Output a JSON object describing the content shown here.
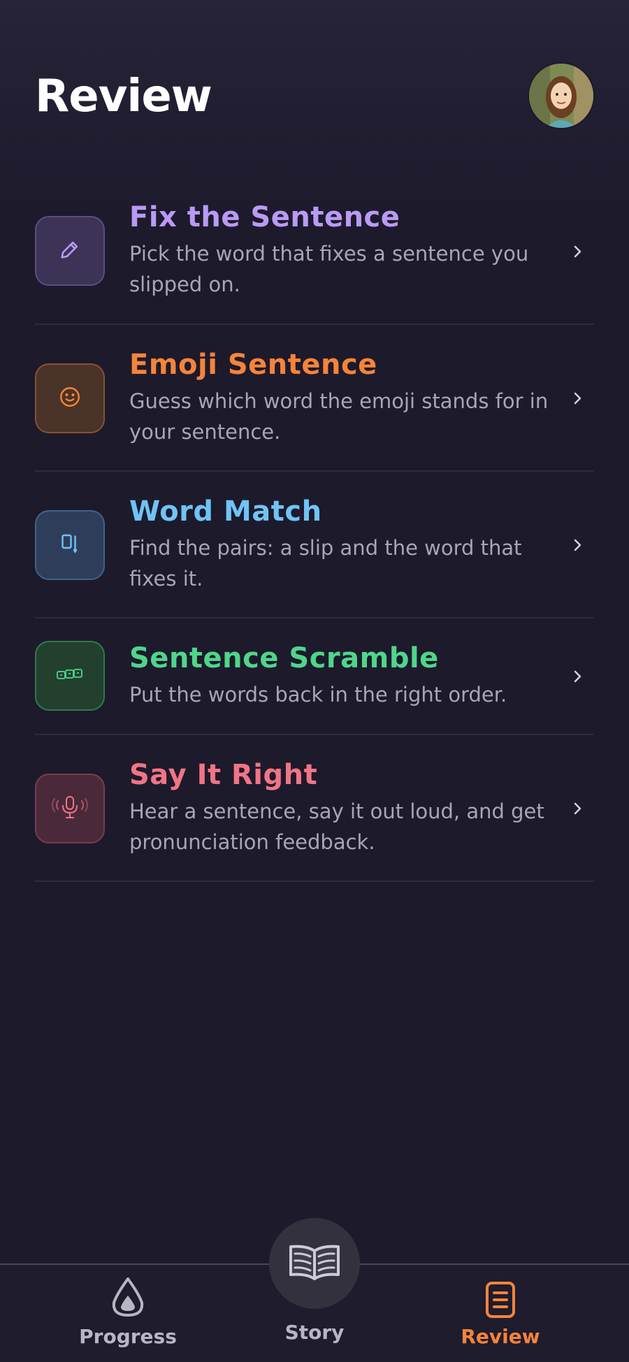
{
  "header": {
    "title": "Review"
  },
  "colors": {
    "background": "#1d1a2c",
    "divider": "#2e2b3e",
    "description": "#a9a5b8",
    "purple": "#b99bf5",
    "orange": "#f5843a",
    "blue": "#6fc4f5",
    "green": "#4fd68a",
    "pink": "#f07585",
    "nav_active": "#f5843a",
    "nav_inactive": "#b8b5c4"
  },
  "review_items": [
    {
      "title": "Fix the Sentence",
      "description": "Pick the word that fixes a sentence you slipped on.",
      "icon": "pencil-icon",
      "color": "#b99bf5"
    },
    {
      "title": "Emoji Sentence",
      "description": "Guess which word the emoji stands for in your sentence.",
      "icon": "smiley-icon",
      "color": "#f5843a"
    },
    {
      "title": "Word Match",
      "description": "Find the pairs: a slip and the word that fixes it.",
      "icon": "match-cards-icon",
      "color": "#6fc4f5"
    },
    {
      "title": "Sentence Scramble",
      "description": "Put the words back in the right order.",
      "icon": "word-blocks-icon",
      "color": "#4fd68a"
    },
    {
      "title": "Say It Right",
      "description": "Hear a sentence, say it out loud, and get pronunciation feedback.",
      "icon": "microphone-icon",
      "color": "#f07585"
    }
  ],
  "bottom_nav": {
    "progress": {
      "label": "Progress",
      "icon": "droplet-icon"
    },
    "story": {
      "label": "Story",
      "icon": "open-book-icon"
    },
    "review": {
      "label": "Review",
      "icon": "document-list-icon",
      "active": true
    }
  }
}
